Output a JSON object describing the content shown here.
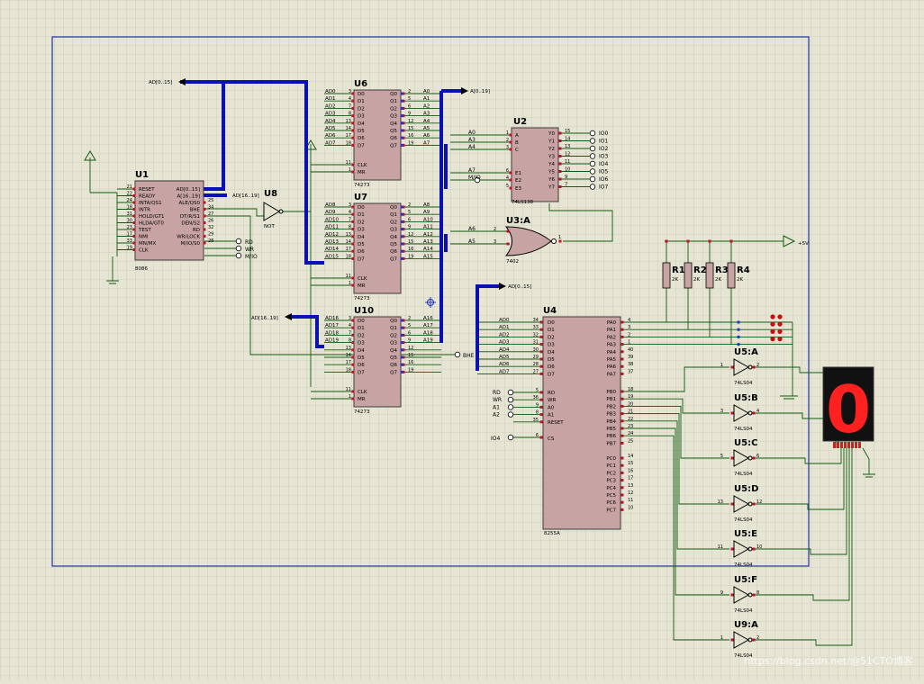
{
  "schematic": {
    "colors": {
      "bus": "#0a10b4",
      "wire": "#105a10",
      "chip": "#c8a3a3",
      "chip_border": "#403a3a",
      "pin_dot": "#c0102a",
      "text": "#000000",
      "grid_frame": "#2233aa",
      "segment": "#ff2020"
    },
    "u1": {
      "ref": "U1",
      "part": "8086",
      "left_pins": [
        {
          "n": "21",
          "s": "RESET"
        },
        {
          "n": "22",
          "s": "READY"
        },
        {
          "n": "24",
          "s": "INTA/QS1"
        },
        {
          "n": "18",
          "s": "INTR"
        },
        {
          "n": "31",
          "s": "HOLD/GT1"
        },
        {
          "n": "30",
          "s": "HLDA/GT0"
        },
        {
          "n": "23",
          "s": "TEST"
        },
        {
          "n": "17",
          "s": "NMI"
        },
        {
          "n": "33",
          "s": "MN/MX"
        },
        {
          "n": "19",
          "s": "CLK"
        }
      ],
      "right_pins": [
        {
          "n": "",
          "s": "AD[0..15]"
        },
        {
          "n": "",
          "s": "A[16..19]"
        },
        {
          "n": "25",
          "s": "ALE/QS0"
        },
        {
          "n": "34",
          "s": "BHE"
        },
        {
          "n": "27",
          "s": "DT/R/S1"
        },
        {
          "n": "26",
          "s": "DEN/S2"
        },
        {
          "n": "32",
          "s": "RD"
        },
        {
          "n": "29",
          "s": "WR/LOCK"
        },
        {
          "n": "28",
          "s": "M/IO/S0"
        }
      ]
    },
    "u8": {
      "ref": "U8",
      "part": "NOT"
    },
    "latches": [
      {
        "ref": "U6",
        "part": "74273",
        "d": [
          {
            "l": "AD0",
            "n": "3"
          },
          {
            "l": "AD1",
            "n": "4"
          },
          {
            "l": "AD2",
            "n": "7"
          },
          {
            "l": "AD3",
            "n": "8"
          },
          {
            "l": "AD4",
            "n": "13"
          },
          {
            "l": "AD5",
            "n": "14"
          },
          {
            "l": "AD6",
            "n": "17"
          },
          {
            "l": "AD7",
            "n": "18"
          }
        ],
        "q": [
          {
            "l": "A0",
            "n": "2"
          },
          {
            "l": "A1",
            "n": "5"
          },
          {
            "l": "A2",
            "n": "6"
          },
          {
            "l": "A3",
            "n": "9"
          },
          {
            "l": "A4",
            "n": "12"
          },
          {
            "l": "A5",
            "n": "15"
          },
          {
            "l": "A6",
            "n": "16"
          },
          {
            "l": "A7",
            "n": "19"
          }
        ]
      },
      {
        "ref": "U7",
        "part": "74273",
        "d": [
          {
            "l": "AD8",
            "n": "3"
          },
          {
            "l": "AD9",
            "n": "4"
          },
          {
            "l": "AD10",
            "n": "7"
          },
          {
            "l": "AD11",
            "n": "8"
          },
          {
            "l": "AD12",
            "n": "13"
          },
          {
            "l": "AD13",
            "n": "14"
          },
          {
            "l": "AD14",
            "n": "17"
          },
          {
            "l": "AD15",
            "n": "18"
          }
        ],
        "q": [
          {
            "l": "A8",
            "n": "2"
          },
          {
            "l": "A9",
            "n": "5"
          },
          {
            "l": "A10",
            "n": "6"
          },
          {
            "l": "A11",
            "n": "9"
          },
          {
            "l": "A12",
            "n": "12"
          },
          {
            "l": "A13",
            "n": "15"
          },
          {
            "l": "A14",
            "n": "16"
          },
          {
            "l": "A15",
            "n": "19"
          }
        ]
      },
      {
        "ref": "U10",
        "part": "74273",
        "d": [
          {
            "l": "AD16",
            "n": "3"
          },
          {
            "l": "AD17",
            "n": "4"
          },
          {
            "l": "AD18",
            "n": "7"
          },
          {
            "l": "AD19",
            "n": "8"
          },
          {
            "l": "",
            "n": "13"
          },
          {
            "l": "",
            "n": "14"
          },
          {
            "l": "",
            "n": "17"
          },
          {
            "l": "",
            "n": "18"
          }
        ],
        "q": [
          {
            "l": "A16",
            "n": "2"
          },
          {
            "l": "A17",
            "n": "5"
          },
          {
            "l": "A18",
            "n": "6"
          },
          {
            "l": "A19",
            "n": "9"
          },
          {
            "l": "",
            "n": "12"
          },
          {
            "l": "",
            "n": "15"
          },
          {
            "l": "",
            "n": "16"
          },
          {
            "l": "",
            "n": "19"
          }
        ]
      }
    ],
    "latch_ctrl": [
      {
        "s": "CLK",
        "n": "11"
      },
      {
        "s": "MR",
        "n": "1"
      }
    ],
    "u2": {
      "ref": "U2",
      "part": "74LS138",
      "in": [
        {
          "s": "A",
          "n": "1",
          "net": "A0"
        },
        {
          "s": "B",
          "n": "2",
          "net": "A3"
        },
        {
          "s": "C",
          "n": "3",
          "net": "A4"
        },
        {
          "s": "E1",
          "n": "6",
          "net": "A7"
        },
        {
          "s": "E2",
          "n": "4",
          "net": "M/IO"
        },
        {
          "s": "E3",
          "n": "5",
          "net": ""
        }
      ],
      "out": [
        {
          "s": "Y0",
          "n": "15",
          "net": "IO0"
        },
        {
          "s": "Y1",
          "n": "14",
          "net": "IO1"
        },
        {
          "s": "Y2",
          "n": "13",
          "net": "IO2"
        },
        {
          "s": "Y3",
          "n": "12",
          "net": "IO3"
        },
        {
          "s": "Y4",
          "n": "11",
          "net": "IO4"
        },
        {
          "s": "Y5",
          "n": "10",
          "net": "IO5"
        },
        {
          "s": "Y6",
          "n": "9",
          "net": "IO6"
        },
        {
          "s": "Y7",
          "n": "7",
          "net": "IO7"
        }
      ]
    },
    "u3": {
      "ref": "U3:A",
      "part": "7402",
      "in_nets": [
        "A6",
        "A5"
      ],
      "pins": [
        "2",
        "3",
        "1"
      ]
    },
    "u4": {
      "ref": "U4",
      "part": "8255A",
      "d": [
        {
          "net": "AD0",
          "n": "34",
          "s": "D0"
        },
        {
          "net": "AD1",
          "n": "33",
          "s": "D1"
        },
        {
          "net": "AD2",
          "n": "32",
          "s": "D2"
        },
        {
          "net": "AD3",
          "n": "31",
          "s": "D3"
        },
        {
          "net": "AD4",
          "n": "30",
          "s": "D4"
        },
        {
          "net": "AD5",
          "n": "29",
          "s": "D5"
        },
        {
          "net": "AD6",
          "n": "28",
          "s": "D6"
        },
        {
          "net": "AD7",
          "n": "27",
          "s": "D7"
        }
      ],
      "ctrl": [
        {
          "net": "RD",
          "n": "5",
          "s": "RD"
        },
        {
          "net": "WR",
          "n": "36",
          "s": "WR"
        },
        {
          "net": "A1",
          "n": "9",
          "s": "A0"
        },
        {
          "net": "A2",
          "n": "8",
          "s": "A1"
        },
        {
          "net": "",
          "n": "35",
          "s": "RESET"
        }
      ],
      "cs": {
        "net": "IO4",
        "n": "6",
        "s": "CS"
      },
      "pa": [
        {
          "s": "PA0",
          "n": "4"
        },
        {
          "s": "PA1",
          "n": "3"
        },
        {
          "s": "PA2",
          "n": "2"
        },
        {
          "s": "PA3",
          "n": "1"
        },
        {
          "s": "PA4",
          "n": "40"
        },
        {
          "s": "PA5",
          "n": "39"
        },
        {
          "s": "PA6",
          "n": "38"
        },
        {
          "s": "PA7",
          "n": "37"
        }
      ],
      "pb": [
        {
          "s": "PB0",
          "n": "18"
        },
        {
          "s": "PB1",
          "n": "19"
        },
        {
          "s": "PB2",
          "n": "20"
        },
        {
          "s": "PB3",
          "n": "21"
        },
        {
          "s": "PB4",
          "n": "22"
        },
        {
          "s": "PB5",
          "n": "23"
        },
        {
          "s": "PB6",
          "n": "24"
        },
        {
          "s": "PB7",
          "n": "25"
        }
      ],
      "pc": [
        {
          "s": "PC0",
          "n": "14"
        },
        {
          "s": "PC1",
          "n": "15"
        },
        {
          "s": "PC2",
          "n": "16"
        },
        {
          "s": "PC3",
          "n": "17"
        },
        {
          "s": "PC4",
          "n": "13"
        },
        {
          "s": "PC5",
          "n": "12"
        },
        {
          "s": "PC6",
          "n": "11"
        },
        {
          "s": "PC7",
          "n": "10"
        }
      ]
    },
    "resistors": [
      {
        "ref": "R1",
        "val": "2K"
      },
      {
        "ref": "R2",
        "val": "2K"
      },
      {
        "ref": "R3",
        "val": "2K"
      },
      {
        "ref": "R4",
        "val": "2K"
      }
    ],
    "vcc_label": "+5V",
    "inverters": [
      {
        "ref": "U5:A",
        "part": "74LS04",
        "pin_in": "1",
        "pin_out": "2"
      },
      {
        "ref": "U5:B",
        "part": "74LS04",
        "pin_in": "3",
        "pin_out": "4"
      },
      {
        "ref": "U5:C",
        "part": "74LS04",
        "pin_in": "5",
        "pin_out": "6"
      },
      {
        "ref": "U5:D",
        "part": "74LS04",
        "pin_in": "13",
        "pin_out": "12"
      },
      {
        "ref": "U5:E",
        "part": "74LS04",
        "pin_in": "11",
        "pin_out": "10"
      },
      {
        "ref": "U5:F",
        "part": "74LS04",
        "pin_in": "9",
        "pin_out": "8"
      },
      {
        "ref": "U9:A",
        "part": "74LS04",
        "pin_in": "1",
        "pin_out": "2"
      }
    ],
    "display_digit": "0",
    "buses": {
      "ad_top": "AD[0..15]",
      "a_top": "A[0..19]",
      "a_u1": "AD[16..19]",
      "ad_u10": "AD[16..19]",
      "ad_u4": "AD[0..15]"
    },
    "nets": {
      "bhe": "BHE",
      "rd": "RD",
      "wr": "WR",
      "mio": "M/IO",
      "mio2": "M/IO",
      "a7": "A7",
      "a6": "A6",
      "a5": "A5",
      "rd_u4": "RD",
      "wr_u4": "WR",
      "a1": "A1",
      "a2": "A2",
      "io4": "IO4"
    },
    "watermark": "https://blog.csdn.net/@51CTO博客"
  }
}
